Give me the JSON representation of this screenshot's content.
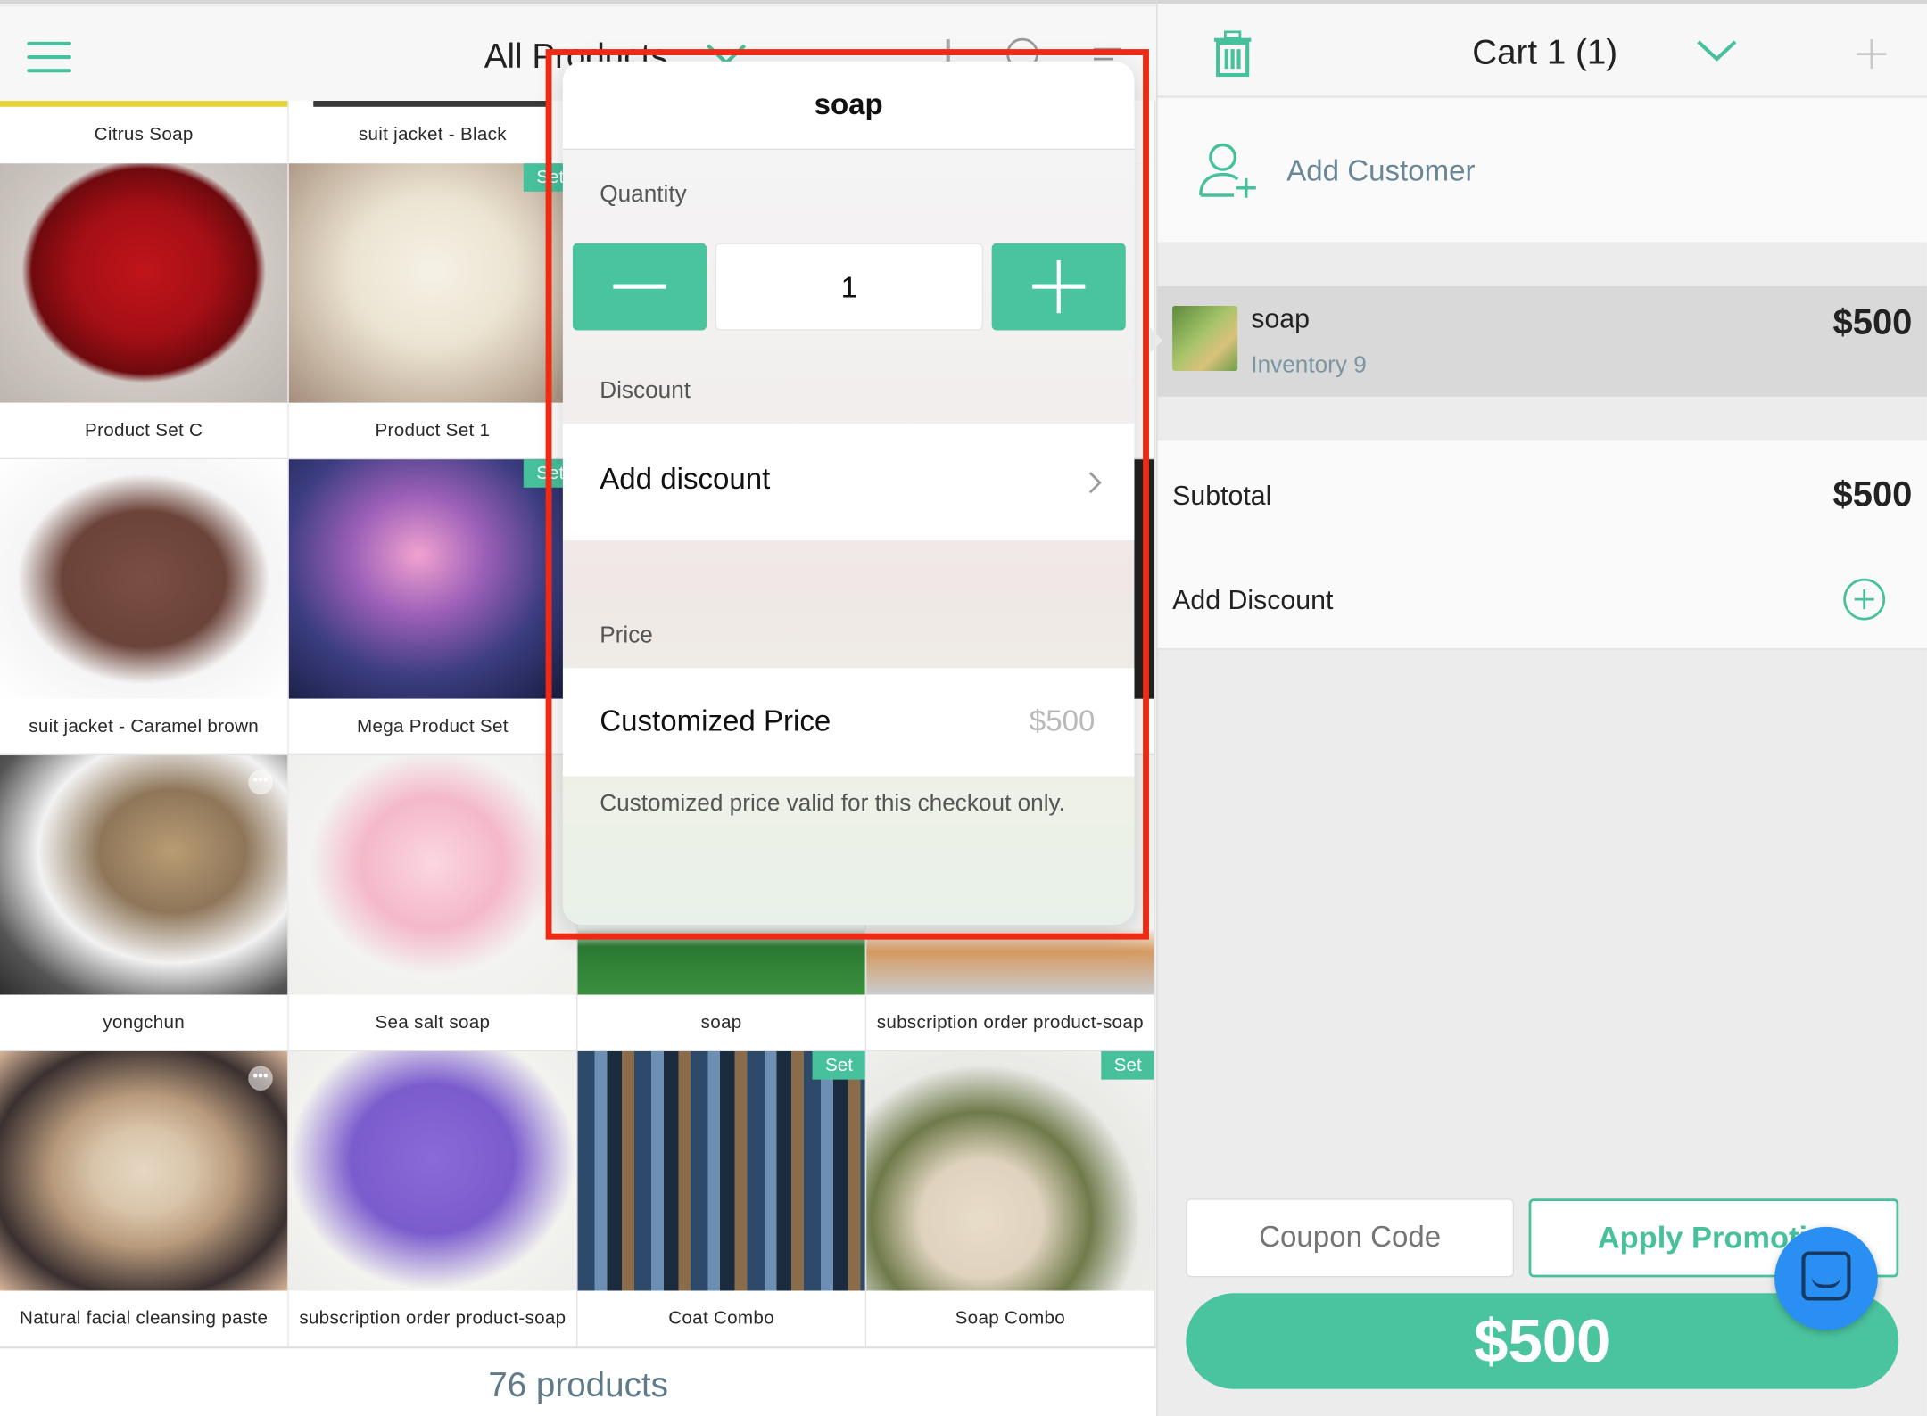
{
  "header": {
    "title": "All Products",
    "icons": [
      "menu-icon",
      "chevron-down-icon",
      "barcode-icon",
      "search-icon",
      "sort-icon"
    ]
  },
  "products": [
    {
      "name": "Citrus Soap",
      "set": false,
      "partial": true
    },
    {
      "name": "suit jacket - Black",
      "set": false,
      "partial": true
    },
    {
      "name": "Product Set C",
      "set": false
    },
    {
      "name": "Product Set 1",
      "set": true
    },
    {
      "name": "suit jacket - Caramel brown",
      "set": false
    },
    {
      "name": "Mega Product Set",
      "set": true
    },
    {
      "name": "yongchun",
      "set": false,
      "more": true
    },
    {
      "name": "Sea salt soap",
      "set": false
    },
    {
      "name": "soap",
      "set": false
    },
    {
      "name": "subscription order product-soap",
      "set": false
    },
    {
      "name": "Natural facial cleansing paste",
      "set": false,
      "more": true
    },
    {
      "name": "subscription order product-soap",
      "set": false
    },
    {
      "name": "Coat Combo",
      "set": true
    },
    {
      "name": "Soap Combo",
      "set": true
    }
  ],
  "set_badge_label": "Set",
  "footer": {
    "count_text": "76 products"
  },
  "popover": {
    "title": "soap",
    "quantity_label": "Quantity",
    "quantity_value": "1",
    "discount_label": "Discount",
    "add_discount": "Add discount",
    "price_label": "Price",
    "customized_price_label": "Customized Price",
    "customized_price_placeholder": "$500",
    "note": "Customized price valid for this checkout only."
  },
  "cart": {
    "title": "Cart 1 (1)",
    "add_customer": "Add Customer",
    "item": {
      "name": "soap",
      "inventory": "Inventory 9",
      "price": "$500"
    },
    "subtotal_label": "Subtotal",
    "subtotal_value": "$500",
    "add_discount_label": "Add Discount",
    "coupon_placeholder": "Coupon Code",
    "apply_promotion_label": "Apply Promoti",
    "checkout_total": "$500"
  },
  "colors": {
    "accent": "#46c19c",
    "highlight": "#ee2a14",
    "chat": "#2a8ff2"
  }
}
